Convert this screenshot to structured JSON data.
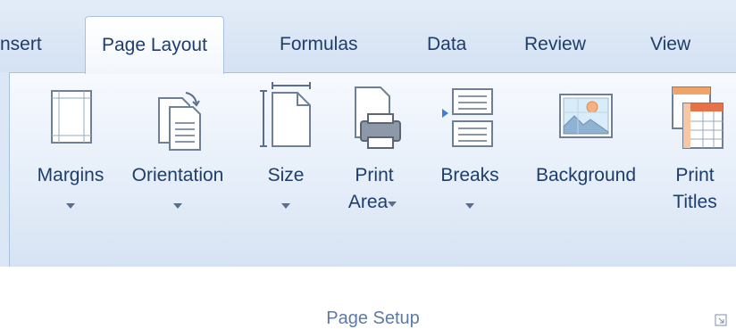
{
  "tabs": [
    {
      "label": "nsert"
    },
    {
      "label": "Page Layout",
      "active": true
    },
    {
      "label": "Formulas"
    },
    {
      "label": "Data"
    },
    {
      "label": "Review"
    },
    {
      "label": "View"
    }
  ],
  "group": {
    "label": "Page Setup",
    "buttons": [
      {
        "label1": "Margins",
        "label2": "",
        "icon": "margins-icon",
        "dropdown": true
      },
      {
        "label1": "Orientation",
        "label2": "",
        "icon": "orientation-icon",
        "dropdown": true
      },
      {
        "label1": "Size",
        "label2": "",
        "icon": "size-icon",
        "dropdown": true
      },
      {
        "label1": "Print",
        "label2": "Area",
        "icon": "print-area-icon",
        "dropdown": true
      },
      {
        "label1": "Breaks",
        "label2": "",
        "icon": "breaks-icon",
        "dropdown": true
      },
      {
        "label1": "Background",
        "label2": "",
        "icon": "background-icon",
        "dropdown": false
      },
      {
        "label1": "Print",
        "label2": "Titles",
        "icon": "print-titles-icon",
        "dropdown": false
      }
    ]
  },
  "colors": {
    "tab_text": "#1e3d6b",
    "group_label": "#5d7aa7",
    "ribbon_border": "#a9c1e0"
  }
}
